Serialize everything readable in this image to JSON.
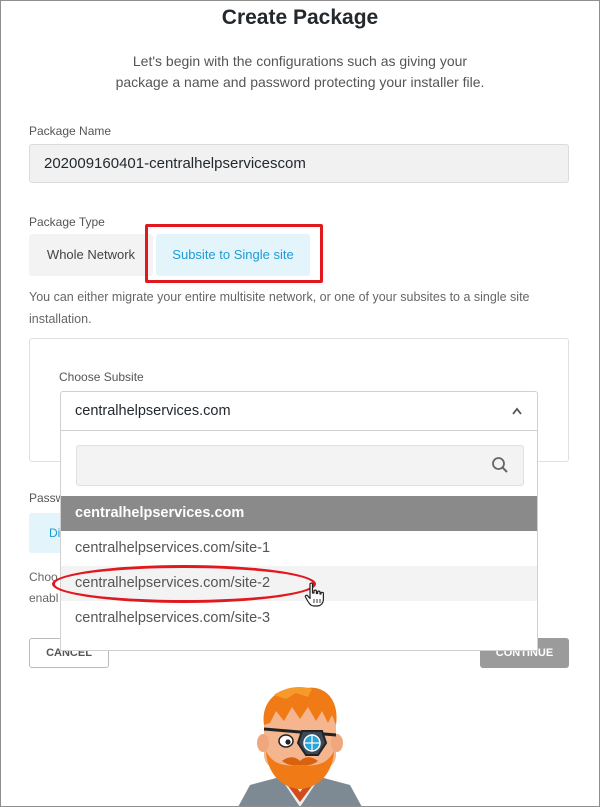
{
  "header": {
    "title": "Create Package",
    "intro_line1": "Let's begin with the configurations such as giving your",
    "intro_line2": "package a name and password protecting your installer file."
  },
  "package_name": {
    "label": "Package Name",
    "value": "202009160401-centralhelpservicescom"
  },
  "package_type": {
    "label": "Package Type",
    "options": [
      "Whole Network",
      "Subsite to Single site"
    ],
    "selected": "Subsite to Single site",
    "help_line1": "You can either migrate your entire multisite network, or one of your subsites to a single site",
    "help_line2": "installation."
  },
  "subsite": {
    "label": "Choose Subsite",
    "selected_value": "centralhelpservices.com",
    "search_placeholder": "",
    "options": [
      "centralhelpservices.com",
      "centralhelpservices.com/site-1",
      "centralhelpservices.com/site-2",
      "centralhelpservices.com/site-3"
    ],
    "highlighted_option": "centralhelpservices.com/site-2"
  },
  "password": {
    "label_partial": "Passw",
    "button_partial": "Di",
    "help_partial_line1": "Choo",
    "help_partial_line2": "enabl"
  },
  "footer": {
    "cancel_label": "CANCEL",
    "continue_label": "CONTINUE"
  },
  "colors": {
    "accent_blue": "#1e9bd7",
    "accent_bg": "#e3f4fb",
    "annotation_red": "#e1191f",
    "selected_item_bg": "#8a8a8a",
    "continue_bg": "#9b9b9b"
  }
}
